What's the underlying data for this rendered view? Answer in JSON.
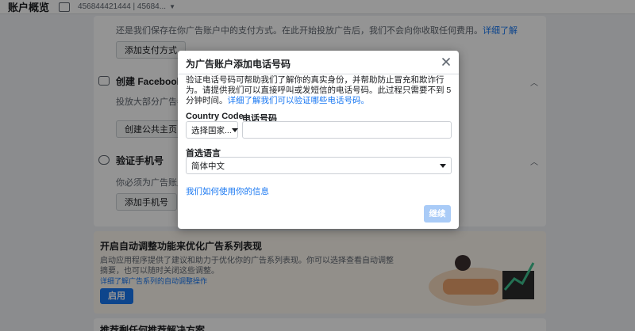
{
  "background": {
    "topbar": {
      "title": "账户概览",
      "account_text": "456844421444 | 45684..."
    },
    "sections": [
      {
        "text": "还是我们保存在你广告账户中的支付方式。在此开始投放广告后，我们不会向你收取任何费用。",
        "link": "详细了解",
        "button": "添加支付方式"
      },
      {
        "heading": "创建 Facebook 公共主页",
        "text": "投放大部分广告都需要...",
        "button": "创建公共主页"
      },
      {
        "heading": "验证手机号",
        "text": "你必须为广告账户...",
        "button": "添加手机号"
      }
    ],
    "promo": {
      "heading": "开启自动调整功能来优化广告系列表现",
      "text_line1": "启动应用程序提供了建议和助力于优化你的广告系列表现。你可以选择查看自动调整",
      "text_line2": "摘要，也可以随时关闭这些调整。",
      "link": "详细了解广告系列的自动调整操作",
      "button": "启用"
    },
    "footer_heading": "推荐剩任何推荐解决方案"
  },
  "dialog": {
    "title": "为广告账户添加电话号码",
    "close_icon": "close-icon",
    "description": "验证电话号码可帮助我们了解你的真实身份，并帮助防止冒充和欺诈行为。请提供我们可以直接呼叫或发短信的电话号码。此过程只需要不到 5 分钟时间。",
    "description_link": "详细了解我们可以验证哪些电话号码。",
    "country_code_label": "Country Code",
    "country_code_value": "选择国家...",
    "phone_label": "电话号码",
    "phone_value": "",
    "language_label": "首选语言",
    "language_value": "简体中文",
    "privacy_link": "我们如何使用你的信息",
    "continue_button": "继续"
  },
  "colors": {
    "accent": "#1877f2",
    "disabled_button": "#a9cbf7",
    "overlay": "#000000"
  }
}
